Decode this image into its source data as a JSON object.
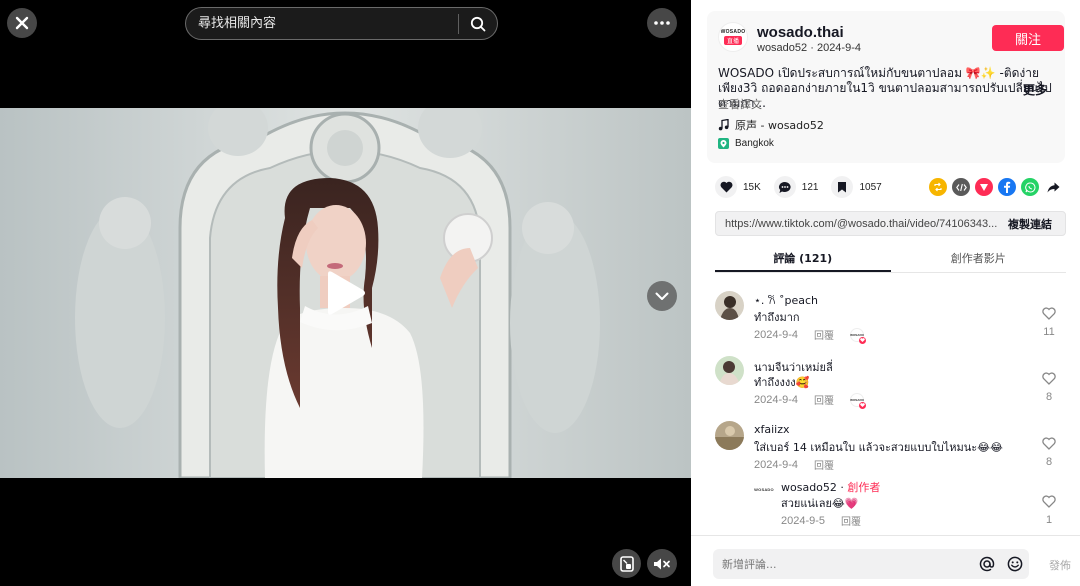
{
  "search": {
    "placeholder": "尋找相關內容"
  },
  "author": {
    "name": "wosado.thai",
    "handle": "wosado52",
    "date": "2024-9-4",
    "avatar_brand": "WOSADO",
    "avatar_badge": "直播"
  },
  "follow_label": "關注",
  "description": {
    "text": "WOSADO เปิดประสบการณ์ใหม่กับขนตาปลอม 🎀✨ -ติดง่ายเพียง3วิ ถอดออกง่ายภายใน1วิ ขนตาปลอมสามารถปรับเปลี่ยนไปตามกา...",
    "more_label": "更多",
    "translate_label": "查看譯文"
  },
  "music": {
    "icon": "music-note-icon",
    "label": "原声 - wosado52"
  },
  "location": {
    "icon": "location-pin-icon",
    "label": "Bangkok"
  },
  "actions": {
    "likes": "15K",
    "comments": "121",
    "saves": "1057"
  },
  "share_colors": {
    "repost": "#f7b500",
    "embed": "#5a5a5a",
    "send": "#fe2c55",
    "facebook": "#1877f2",
    "whatsapp": "#25d366"
  },
  "link": {
    "url": "https://www.tiktok.com/@wosado.thai/video/74106343...",
    "copy_label": "複製連結"
  },
  "tabs": [
    {
      "label": "評論 (121)",
      "active": true
    },
    {
      "label": "創作者影片",
      "active": false
    }
  ],
  "comments": [
    {
      "user": "⋆. 𐙚 ˚peach",
      "text": "ทำถึงมาก",
      "date": "2024-9-4",
      "reply_label": "回覆",
      "likes": "11",
      "creator_liked": true
    },
    {
      "user": "นามจีนว่าเหม่ยลี่",
      "text": "ทำถึงงงง🥰",
      "date": "2024-9-4",
      "reply_label": "回覆",
      "likes": "8",
      "creator_liked": true
    },
    {
      "user": "xfaiizx",
      "text": "ใส่เบอร์ 14 เหมือนใบ แล้วจะสวยแบบใบไหมนะ😂😂",
      "date": "2024-9-4",
      "reply_label": "回覆",
      "likes": "8",
      "creator_liked": false
    }
  ],
  "creator_reply": {
    "user": "wosado52",
    "creator_label": "創作者",
    "separator": "·",
    "text": "สวยแน่เลย😂💗",
    "date": "2024-9-5",
    "reply_label": "回覆",
    "likes": "1"
  },
  "liked_by_creator_mark": "WOSADO",
  "comment_input": {
    "placeholder": "新增評論...",
    "post_label": "發佈"
  },
  "colors": {
    "accent": "#fe2c55",
    "panel_bg": "#f8f8f8"
  }
}
